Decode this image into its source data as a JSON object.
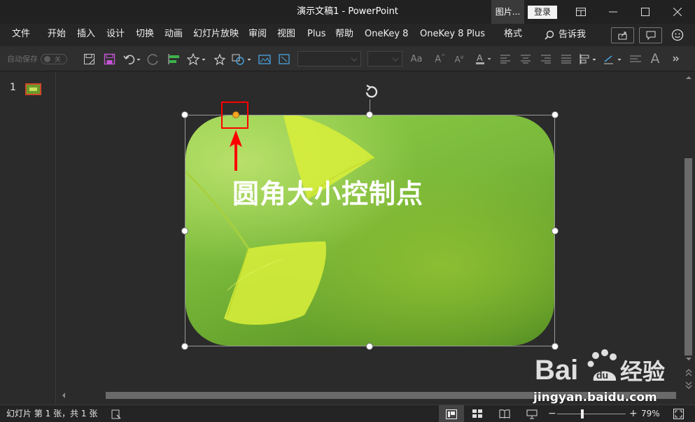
{
  "window": {
    "title": "演示文稿1  -  PowerPoint",
    "context_tab": "图片...",
    "login_label": "登录"
  },
  "menu": {
    "items": [
      "文件",
      "开始",
      "插入",
      "设计",
      "切换",
      "动画",
      "幻灯片放映",
      "审阅",
      "视图",
      "Plus",
      "帮助",
      "OneKey 8",
      "OneKey 8 Plus",
      "格式"
    ],
    "tell_me": "告诉我"
  },
  "toolbar": {
    "autosave_label": "自动保存",
    "autosave_state": "关"
  },
  "slides": {
    "current_number": "1"
  },
  "canvas": {
    "picture_caption": "圆角大小控制点"
  },
  "status": {
    "slide_info": "幻灯片 第 1 张，共 1 张",
    "zoom": "79%"
  },
  "watermark": {
    "url": "jingyan.baidu.com"
  },
  "colors": {
    "highlight": "#ff0000",
    "adjust_handle": "#f5a623",
    "accent_red": "#d24726"
  }
}
